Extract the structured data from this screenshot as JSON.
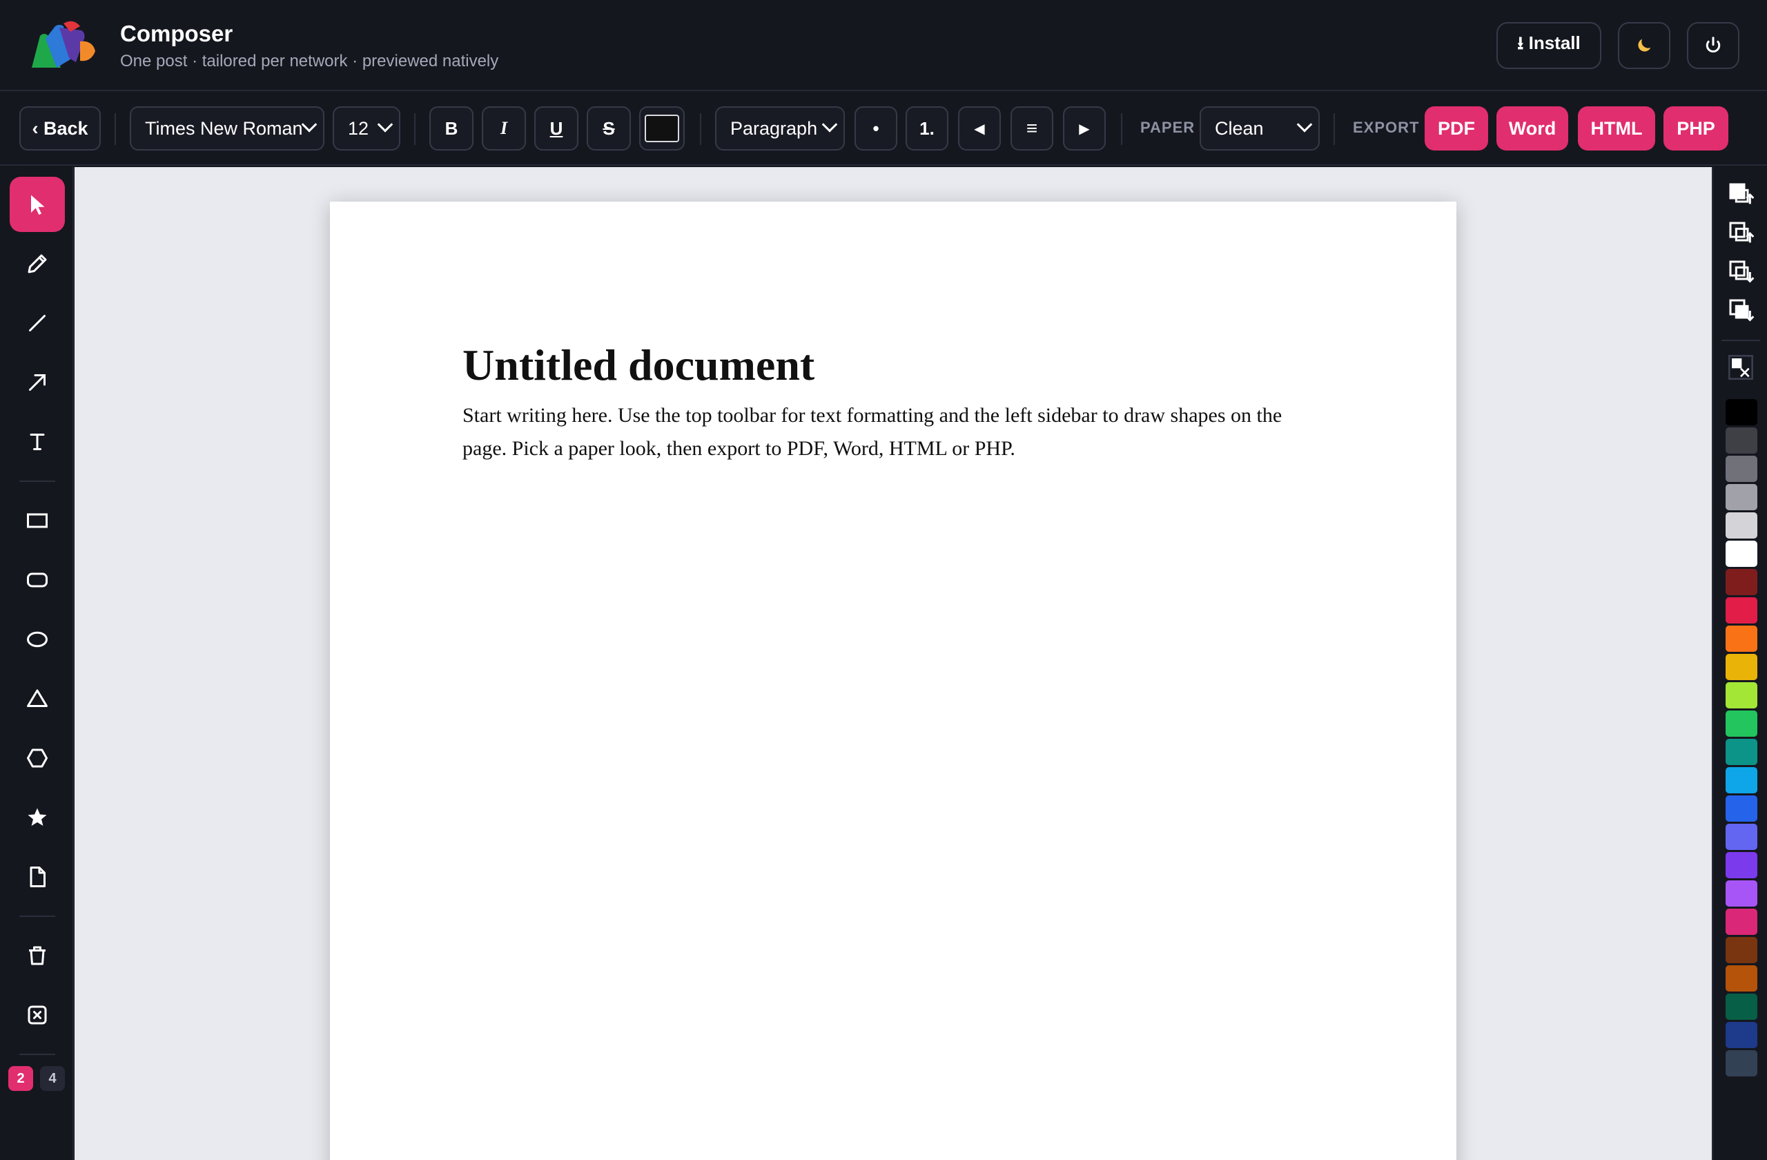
{
  "header": {
    "title": "Composer",
    "subtitle": "One post · tailored per network · previewed natively",
    "install_label": "⭳ Install"
  },
  "toolbar": {
    "back_label": "‹ Back",
    "font_family": "Times New Roman",
    "font_size": "12",
    "bold_label": "B",
    "italic_label": "I",
    "underline_label": "U",
    "strike_label": "S",
    "text_color": "#111111",
    "block_style": "Paragraph",
    "bullet_label": "•",
    "numbered_label": "1.",
    "outdent_label": "◀",
    "align_label": "≡",
    "indent_label": "▶",
    "paper_label": "PAPER",
    "paper_value": "Clean",
    "export_label": "EXPORT",
    "export_buttons": [
      "PDF",
      "Word",
      "HTML",
      "PHP"
    ]
  },
  "sidebar": {
    "tools": [
      "select",
      "pencil",
      "line",
      "arrow",
      "text",
      "rectangle",
      "rounded-rectangle",
      "ellipse",
      "triangle",
      "hexagon",
      "star",
      "page",
      "delete",
      "clear"
    ],
    "active_tool": "select",
    "current_page": "2",
    "total_pages": "4"
  },
  "document": {
    "title": "Untitled document",
    "body": "Start writing here. Use the top toolbar for text formatting and the left sidebar to draw shapes on the page. Pick a paper look, then export to PDF, Word, HTML or PHP."
  },
  "palette": [
    "#000000",
    "#3f3f46",
    "#71717a",
    "#a1a1aa",
    "#d4d4d8",
    "#ffffff",
    "#7f1d1d",
    "#e11d48",
    "#f97316",
    "#eab308",
    "#a3e635",
    "#22c55e",
    "#0d9488",
    "#0ea5e9",
    "#2563eb",
    "#6366f1",
    "#7c3aed",
    "#a855f7",
    "#db2777",
    "#78350f",
    "#b45309",
    "#065f46",
    "#1e3a8a",
    "#334155"
  ],
  "colors": {
    "accent": "#e12e6e",
    "background": "#15171f",
    "canvas": "#e8eaef"
  }
}
